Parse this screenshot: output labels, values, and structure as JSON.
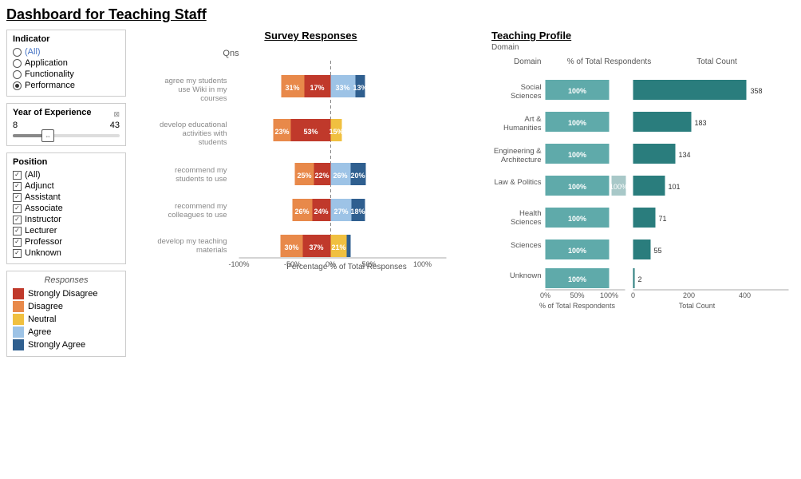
{
  "title": "Dashboard for Teaching Staff",
  "filters": {
    "indicator": {
      "label": "Indicator",
      "options": [
        "(All)",
        "Application",
        "Functionality",
        "Performance"
      ]
    },
    "yearExperience": {
      "label": "Year of Experience",
      "min": "8",
      "max": "43"
    },
    "position": {
      "label": "Position",
      "options": [
        "(All)",
        "Adjunct",
        "Assistant",
        "Associate",
        "Instructor",
        "Lecturer",
        "Professor",
        "Unknown"
      ]
    }
  },
  "legend": {
    "title": "Responses",
    "items": [
      "Strongly Disagree",
      "Disagree",
      "Neutral",
      "Agree",
      "Strongly Agree"
    ]
  },
  "surveyChart": {
    "title": "Survey Responses",
    "columnHeader": "Qns",
    "xAxisLabel": "Percentage % of Total Responses",
    "bars": [
      {
        "label": "agree my students use Wiki in my courses",
        "values": {
          "SD": 17,
          "D": 31,
          "N": 0,
          "A": 33,
          "SA": 13
        }
      },
      {
        "label": "develop educational activities with students",
        "values": {
          "SD": 53,
          "D": 23,
          "N": 15,
          "A": 0,
          "SA": 0
        }
      },
      {
        "label": "recommend my students to use",
        "values": {
          "SD": 22,
          "D": 25,
          "N": 0,
          "A": 26,
          "SA": 20
        }
      },
      {
        "label": "recommend my colleagues to use",
        "values": {
          "SD": 24,
          "D": 26,
          "N": 0,
          "A": 27,
          "SA": 18
        }
      },
      {
        "label": "develop my teaching materials",
        "values": {
          "SD": 37,
          "D": 30,
          "N": 21,
          "A": 0,
          "SA": 0
        }
      }
    ]
  },
  "teachingChart": {
    "title": "Teaching Profile",
    "domainLabel": "Domain",
    "domains": [
      {
        "name": "Social Sciences",
        "pct": 100,
        "count": 358
      },
      {
        "name": "Art & Humanities",
        "pct": 100,
        "count": 183
      },
      {
        "name": "Engineering & Architecture",
        "pct": 100,
        "count": 134
      },
      {
        "name": "Law & Politics",
        "pct": 100,
        "count": 101
      },
      {
        "name": "Health Sciences",
        "pct": 100,
        "count": 71
      },
      {
        "name": "Sciences",
        "pct": 100,
        "count": 55
      },
      {
        "name": "Unknown",
        "pct": 100,
        "count": 2
      }
    ],
    "xLabelsLeft": [
      "0%",
      "50%",
      "100%"
    ],
    "xLabelsRight": [
      "0",
      "200",
      "400"
    ],
    "xAxisLabelLeft": "% of Total Respondents",
    "xAxisLabelRight": "Total Count"
  }
}
